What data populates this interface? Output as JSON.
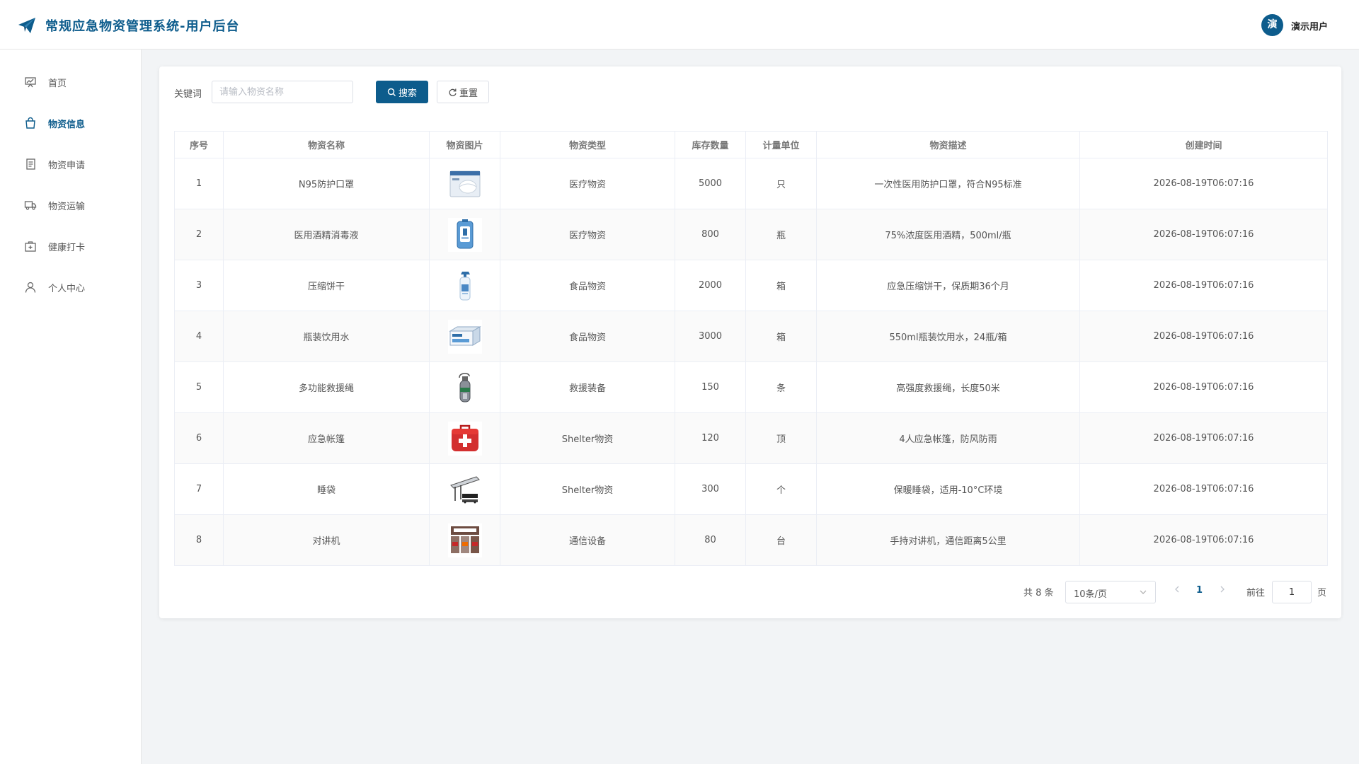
{
  "header": {
    "title": "常规应急物资管理系统-用户后台",
    "avatar_char": "演",
    "user_name": "演示用户"
  },
  "sidebar": {
    "items": [
      {
        "label": "首页",
        "icon": "presentation-icon",
        "active": false
      },
      {
        "label": "物资信息",
        "icon": "bag-icon",
        "active": true
      },
      {
        "label": "物资申请",
        "icon": "document-icon",
        "active": false
      },
      {
        "label": "物资运输",
        "icon": "truck-icon",
        "active": false
      },
      {
        "label": "健康打卡",
        "icon": "first-aid-icon",
        "active": false
      },
      {
        "label": "个人中心",
        "icon": "user-icon",
        "active": false
      }
    ]
  },
  "search": {
    "label": "关键词",
    "placeholder": "请输入物资名称",
    "value": "",
    "search_label": "搜索",
    "reset_label": "重置"
  },
  "table": {
    "columns": [
      "序号",
      "物资名称",
      "物资图片",
      "物资类型",
      "库存数量",
      "计量单位",
      "物资描述",
      "创建时间"
    ],
    "rows": [
      {
        "no": "1",
        "name": "N95防护口罩",
        "image": "mask-box-icon",
        "type": "医疗物资",
        "qty": "5000",
        "unit": "只",
        "desc": "一次性医用防护口罩，符合N95标准",
        "created": "2026-08-19T06:07:16"
      },
      {
        "no": "2",
        "name": "医用酒精消毒液",
        "image": "alcohol-bottle-icon",
        "type": "医疗物资",
        "qty": "800",
        "unit": "瓶",
        "desc": "75%浓度医用酒精，500ml/瓶",
        "created": "2026-08-19T06:07:16"
      },
      {
        "no": "3",
        "name": "压缩饼干",
        "image": "spray-bottle-icon",
        "type": "食品物资",
        "qty": "2000",
        "unit": "箱",
        "desc": "应急压缩饼干，保质期36个月",
        "created": "2026-08-19T06:07:16"
      },
      {
        "no": "4",
        "name": "瓶装饮用水",
        "image": "carton-icon",
        "type": "食品物资",
        "qty": "3000",
        "unit": "箱",
        "desc": "550ml瓶装饮用水，24瓶/箱",
        "created": "2026-08-19T06:07:16"
      },
      {
        "no": "5",
        "name": "多功能救援绳",
        "image": "oxygen-tank-icon",
        "type": "救援装备",
        "qty": "150",
        "unit": "条",
        "desc": "高强度救援绳，长度50米",
        "created": "2026-08-19T06:07:16"
      },
      {
        "no": "6",
        "name": "应急帐篷",
        "image": "first-aid-kit-icon",
        "type": "Shelter物资",
        "qty": "120",
        "unit": "顶",
        "desc": "4人应急帐篷，防风防雨",
        "created": "2026-08-19T06:07:16"
      },
      {
        "no": "7",
        "name": "睡袋",
        "image": "stretcher-icon",
        "type": "Shelter物资",
        "qty": "300",
        "unit": "个",
        "desc": "保暖睡袋，适用-10°C环境",
        "created": "2026-08-19T06:07:16"
      },
      {
        "no": "8",
        "name": "对讲机",
        "image": "supply-boxes-icon",
        "type": "通信设备",
        "qty": "80",
        "unit": "台",
        "desc": "手持对讲机，通信距离5公里",
        "created": "2026-08-19T06:07:16"
      }
    ]
  },
  "pagination": {
    "total": "共 8 条",
    "page_size": "10条/页",
    "current_page": "1",
    "goto_label": "前往",
    "goto_value": "1",
    "page_unit": "页"
  },
  "colors": {
    "primary": "#0d5c8c",
    "background": "#f2f4f6"
  }
}
